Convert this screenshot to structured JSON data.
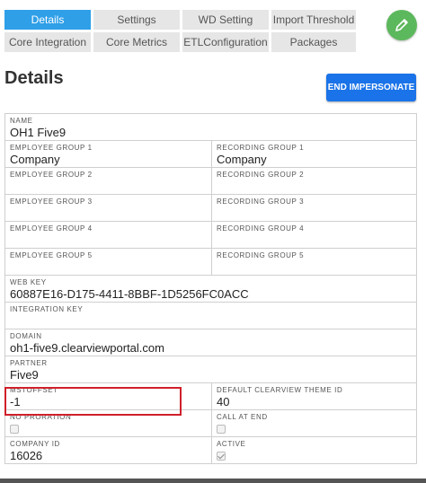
{
  "tabs": {
    "row1": [
      "Details",
      "Settings",
      "WD Setting",
      "Import Threshold"
    ],
    "row2": [
      "Core Integration",
      "Core Metrics",
      "ETLConfiguration",
      "Packages"
    ],
    "active": "Details"
  },
  "icons": {
    "edit": "pencil-icon"
  },
  "colors": {
    "tab_active": "#2f9fe8",
    "edit_button": "#5cb85c",
    "primary_button": "#1a73e8",
    "highlight": "#d0202a"
  },
  "page": {
    "title": "Details",
    "end_impersonate": "END IMPERSONATE"
  },
  "fields": {
    "name": {
      "label": "NAME",
      "value": "OH1 Five9"
    },
    "employee_group_1": {
      "label": "EMPLOYEE GROUP 1",
      "value": "Company"
    },
    "recording_group_1": {
      "label": "RECORDING GROUP 1",
      "value": "Company"
    },
    "employee_group_2": {
      "label": "EMPLOYEE GROUP 2",
      "value": ""
    },
    "recording_group_2": {
      "label": "RECORDING GROUP 2",
      "value": ""
    },
    "employee_group_3": {
      "label": "EMPLOYEE GROUP 3",
      "value": ""
    },
    "recording_group_3": {
      "label": "RECORDING GROUP 3",
      "value": ""
    },
    "employee_group_4": {
      "label": "EMPLOYEE GROUP 4",
      "value": ""
    },
    "recording_group_4": {
      "label": "RECORDING GROUP 4",
      "value": ""
    },
    "employee_group_5": {
      "label": "EMPLOYEE GROUP 5",
      "value": ""
    },
    "recording_group_5": {
      "label": "RECORDING GROUP 5",
      "value": ""
    },
    "web_key": {
      "label": "WEB KEY",
      "value": "60887E16-D175-4411-8BBF-1D5256FC0ACC"
    },
    "integration_key": {
      "label": "INTEGRATION KEY",
      "value": ""
    },
    "domain": {
      "label": "DOMAIN",
      "value": "oh1-five9.clearviewportal.com"
    },
    "partner": {
      "label": "PARTNER",
      "value": "Five9"
    },
    "mstoffset": {
      "label": "MSTOFFSET",
      "value": "-1"
    },
    "default_theme_id": {
      "label": "DEFAULT CLEARVIEW THEME ID",
      "value": "40"
    },
    "no_proration": {
      "label": "NO PRORATION",
      "checked": false
    },
    "call_at_end": {
      "label": "CALL AT END",
      "checked": false
    },
    "company_id": {
      "label": "COMPANY ID",
      "value": "16026"
    },
    "active": {
      "label": "ACTIVE",
      "checked": true
    }
  }
}
